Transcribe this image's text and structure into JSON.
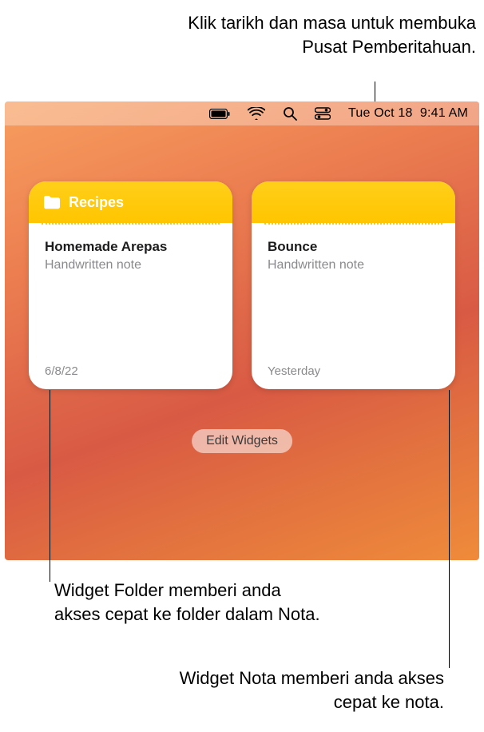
{
  "callouts": {
    "top": "Klik tarikh dan masa untuk membuka Pusat Pemberitahuan.",
    "left": "Widget Folder memberi anda akses cepat ke folder dalam Nota.",
    "right": "Widget Nota memberi anda akses cepat ke nota."
  },
  "menubar": {
    "icons": {
      "battery": "battery-icon",
      "wifi": "wifi-icon",
      "search": "search-icon",
      "control_center": "control-center-icon"
    },
    "date": "Tue Oct 18",
    "time": "9:41 AM"
  },
  "widgets": {
    "folder": {
      "header_title": "Recipes",
      "note_title": "Homemade Arepas",
      "note_subtitle": "Handwritten note",
      "date": "6/8/22"
    },
    "note": {
      "note_title": "Bounce",
      "note_subtitle": "Handwritten note",
      "date": "Yesterday"
    }
  },
  "edit_widgets_label": "Edit Widgets"
}
